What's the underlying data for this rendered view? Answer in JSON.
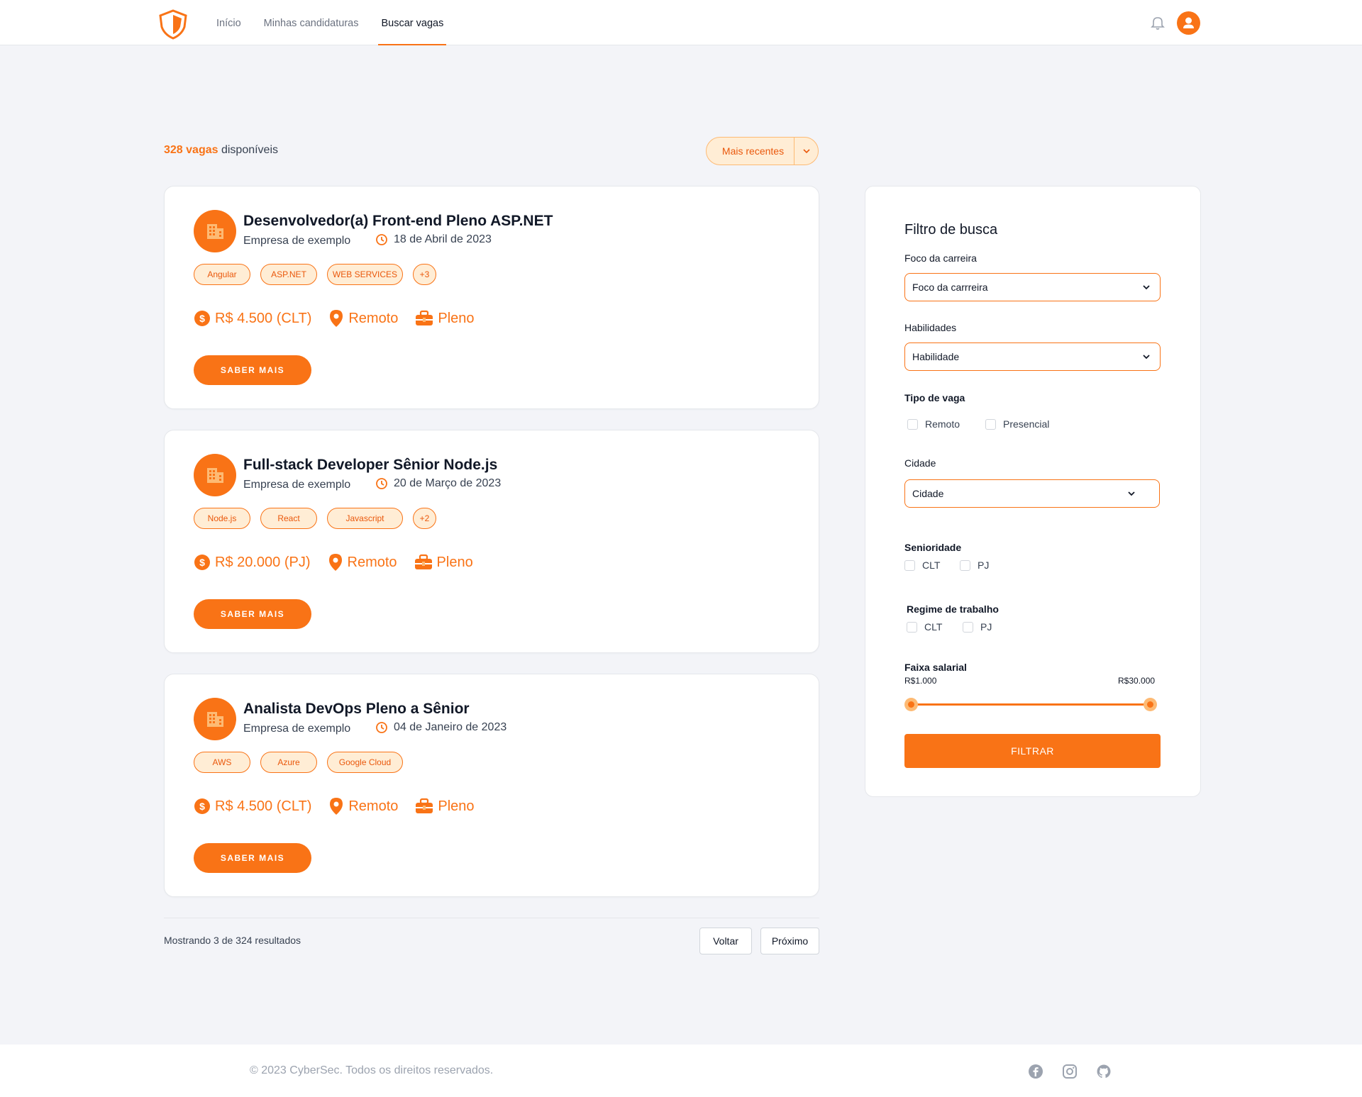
{
  "nav": {
    "items": [
      {
        "label": "Início"
      },
      {
        "label": "Minhas candidaturas"
      },
      {
        "label": "Buscar vagas"
      }
    ],
    "active": 2
  },
  "results": {
    "count": "328 vagas",
    "suffix": " disponíveis",
    "sort_label": "Mais recentes"
  },
  "jobs": [
    {
      "title": "Desenvolvedor(a) Front-end Pleno ASP.NET",
      "company": "Empresa de exemplo",
      "date": "18 de Abril de 2023",
      "tags": [
        "Angular",
        "ASP.NET",
        "WEB SERVICES",
        "+3"
      ],
      "salary": "R$ 4.500 (CLT)",
      "location": "Remoto",
      "level": "Pleno",
      "button": "SABER MAIS"
    },
    {
      "title": "Full-stack Developer Sênior Node.js",
      "company": "Empresa de exemplo",
      "date": "20 de Março de 2023",
      "tags": [
        "Node.js",
        "React",
        "Javascript",
        "+2"
      ],
      "salary": "R$ 20.000 (PJ)",
      "location": "Remoto",
      "level": "Pleno",
      "button": "SABER MAIS"
    },
    {
      "title": "Analista DevOps Pleno a Sênior",
      "company": "Empresa de exemplo",
      "date": "04 de Janeiro de 2023",
      "tags": [
        "AWS",
        "Azure",
        "Google Cloud"
      ],
      "salary": "R$ 4.500 (CLT)",
      "location": "Remoto",
      "level": "Pleno",
      "button": "SABER MAIS"
    }
  ],
  "pagination": {
    "text": "Mostrando 3 de 324 resultados",
    "prev": "Voltar",
    "next": "Próximo"
  },
  "filter": {
    "title": "Filtro de busca",
    "career_label": "Foco da carreira",
    "career_value": "Foco da carrreira",
    "skills_label": "Habilidades",
    "skills_value": "Habilidade",
    "type_label": "Tipo de vaga",
    "type_remote": "Remoto",
    "type_onsite": "Presencial",
    "city_label": "Cidade",
    "city_value": "Cidade",
    "seniority_label": "Senioridade",
    "seniority_a": "CLT",
    "seniority_b": "PJ",
    "regime_label": "Regime de trabalho",
    "regime_a": "CLT",
    "regime_b": "PJ",
    "salary_label": "Faixa salarial",
    "salary_min": "R$1.000",
    "salary_max": "R$30.000",
    "button": "FILTRAR"
  },
  "footer": {
    "text": "© 2023 CyberSec. Todos os direitos reservados."
  },
  "colors": {
    "accent": "#f97316",
    "accent_light": "#ffedd5",
    "background": "#f3f4f8"
  },
  "icons": [
    "shield-logo",
    "bell-icon",
    "user-icon",
    "building-icon",
    "clock-icon",
    "dollar-icon",
    "pin-icon",
    "briefcase-icon",
    "chevron-down-icon",
    "facebook-icon",
    "instagram-icon",
    "github-icon"
  ]
}
